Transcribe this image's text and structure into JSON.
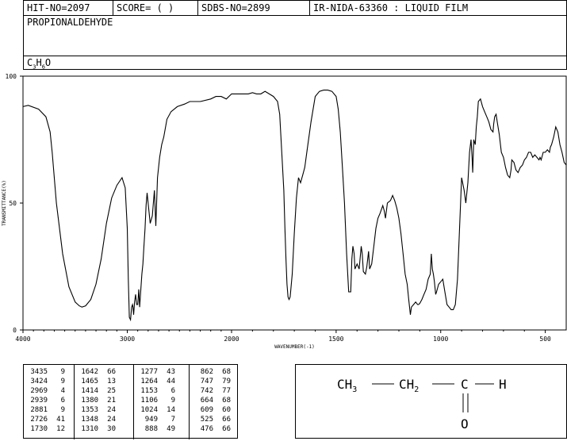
{
  "header": {
    "hit_no": "HIT-NO=2097",
    "score": "SCORE=  (   )",
    "sdbs_no": "SDBS-NO=2899",
    "ir_label": "IR-NIDA-63360 : LIQUID FILM"
  },
  "compound": {
    "name": "PROPIONALDEHYDE",
    "formula": {
      "c": "C",
      "c_sub": "3",
      "h": "H",
      "h_sub": "6",
      "o": "O"
    }
  },
  "structure": {
    "ch3": "CH",
    "ch3_sub": "3",
    "ch2": "CH",
    "ch2_sub": "2",
    "c": "C",
    "h": "H",
    "o": "O"
  },
  "chart_data": {
    "type": "line",
    "xlabel": "WAVENUMBER(-1)",
    "ylabel": "TRANSMITTANCE(%)",
    "xlim": [
      4000,
      400
    ],
    "ylim": [
      0,
      100
    ],
    "xticks": [
      "4000",
      "3000",
      "2000",
      "1500",
      "1000",
      "500"
    ],
    "xtick_values": [
      4000,
      3000,
      2000,
      1500,
      1000,
      500
    ],
    "yticks": [
      "0",
      "50",
      "100"
    ],
    "ytick_values": [
      0,
      50,
      100
    ],
    "grid": false,
    "series": [
      {
        "x": [
          4000,
          3950,
          3850,
          3780,
          3740,
          3720,
          3680,
          3620,
          3560,
          3500,
          3460,
          3435,
          3400,
          3350,
          3300,
          3250,
          3200,
          3150,
          3100,
          3050,
          3020,
          3000,
          2990,
          2980,
          2969,
          2958,
          2950,
          2945,
          2939,
          2930,
          2920,
          2910,
          2900,
          2890,
          2881,
          2870,
          2860,
          2850,
          2840,
          2830,
          2820,
          2810,
          2800,
          2790,
          2780,
          2760,
          2740,
          2726,
          2710,
          2690,
          2670,
          2650,
          2620,
          2580,
          2520,
          2450,
          2400,
          2300,
          2200,
          2150,
          2100,
          2050,
          2000,
          1980,
          1950,
          1920,
          1900,
          1880,
          1860,
          1840,
          1820,
          1800,
          1780,
          1770,
          1760,
          1750,
          1745,
          1740,
          1735,
          1730,
          1725,
          1720,
          1710,
          1700,
          1690,
          1680,
          1670,
          1660,
          1650,
          1640,
          1620,
          1600,
          1580,
          1560,
          1540,
          1520,
          1500,
          1490,
          1480,
          1470,
          1460,
          1450,
          1440,
          1430,
          1425,
          1420,
          1414,
          1410,
          1400,
          1390,
          1380,
          1375,
          1370,
          1360,
          1353,
          1345,
          1340,
          1330,
          1320,
          1310,
          1300,
          1290,
          1277,
          1270,
          1264,
          1255,
          1240,
          1230,
          1220,
          1210,
          1200,
          1190,
          1180,
          1170,
          1160,
          1153,
          1145,
          1140,
          1130,
          1120,
          1110,
          1106,
          1100,
          1090,
          1080,
          1070,
          1060,
          1050,
          1045,
          1040,
          1035,
          1030,
          1024,
          1020,
          1010,
          1000,
          990,
          980,
          970,
          960,
          950,
          940,
          930,
          920,
          910,
          900,
          888,
          880,
          870,
          862,
          855,
          850,
          847,
          842,
          835,
          830,
          825,
          820,
          810,
          800,
          790,
          780,
          770,
          760,
          750,
          747,
          742,
          735,
          730,
          720,
          710,
          700,
          690,
          680,
          670,
          664,
          660,
          650,
          640,
          630,
          620,
          609,
          600,
          590,
          580,
          570,
          560,
          550,
          540,
          530,
          525,
          520,
          510,
          500,
          490,
          480,
          476,
          470,
          460,
          450,
          440,
          430,
          420,
          410,
          400
        ],
        "y": [
          88,
          88.5,
          87,
          84,
          78,
          70,
          50,
          30,
          17,
          11,
          9.5,
          9,
          9.5,
          12,
          18,
          28,
          42,
          52,
          57,
          60,
          56,
          40,
          20,
          5,
          4,
          9,
          10,
          9,
          6,
          11,
          14,
          10,
          10,
          16,
          9,
          16,
          22,
          26,
          33,
          40,
          49,
          54,
          50,
          46,
          42,
          45,
          55,
          41,
          60,
          68,
          73,
          76,
          83,
          86,
          88,
          89,
          90,
          90,
          91,
          92,
          92,
          91,
          93,
          93,
          93,
          93,
          93.5,
          93,
          93,
          94,
          93,
          92,
          90,
          85,
          70,
          55,
          40,
          28,
          18,
          13,
          12,
          13,
          22,
          38,
          52,
          60,
          58,
          61,
          64,
          70,
          82,
          92,
          94,
          94.5,
          94.5,
          94,
          92,
          87,
          78,
          64,
          50,
          30,
          15,
          15,
          28,
          33,
          30,
          24,
          26,
          24,
          33,
          30,
          23,
          22,
          25,
          31,
          24,
          26,
          33,
          40,
          44,
          46,
          49,
          47,
          44,
          50,
          51,
          53,
          51,
          48,
          44,
          38,
          30,
          22,
          18,
          12,
          6,
          9,
          10,
          11,
          10,
          10,
          10.5,
          12,
          14,
          16,
          20,
          22,
          30,
          24,
          22,
          19,
          14,
          15,
          18,
          19,
          20,
          15,
          10,
          9,
          8,
          8,
          10,
          20,
          40,
          60,
          55,
          50,
          58,
          70,
          75,
          68,
          62,
          75,
          73,
          80,
          84,
          90,
          91,
          88,
          86,
          84,
          82,
          79,
          78,
          81,
          84,
          85,
          82,
          77,
          70,
          68,
          64,
          61,
          60,
          63,
          67,
          66,
          63,
          62,
          64,
          65,
          67,
          68,
          70,
          70,
          68,
          69,
          68,
          67,
          68,
          67,
          70,
          70,
          71,
          70,
          72,
          73,
          76,
          80,
          78,
          73,
          70,
          66,
          65
        ]
      }
    ]
  },
  "peak_table": [
    [
      [
        "3435",
        "9"
      ],
      [
        "3424",
        "9"
      ],
      [
        "2969",
        "4"
      ],
      [
        "2939",
        "6"
      ],
      [
        "2881",
        "9"
      ],
      [
        "2726",
        "41"
      ],
      [
        "1730",
        "12"
      ]
    ],
    [
      [
        "1642",
        "66"
      ],
      [
        "1465",
        "13"
      ],
      [
        "1414",
        "25"
      ],
      [
        "1380",
        "21"
      ],
      [
        "1353",
        "24"
      ],
      [
        "1348",
        "24"
      ],
      [
        "1310",
        "30"
      ]
    ],
    [
      [
        "1277",
        "43"
      ],
      [
        "1264",
        "44"
      ],
      [
        "1153",
        "6"
      ],
      [
        "1106",
        "9"
      ],
      [
        "1024",
        "14"
      ],
      [
        "949",
        "7"
      ],
      [
        "888",
        "49"
      ]
    ],
    [
      [
        "862",
        "68"
      ],
      [
        "747",
        "79"
      ],
      [
        "742",
        "77"
      ],
      [
        "664",
        "68"
      ],
      [
        "609",
        "60"
      ],
      [
        "525",
        "66"
      ],
      [
        "476",
        "66"
      ]
    ]
  ]
}
